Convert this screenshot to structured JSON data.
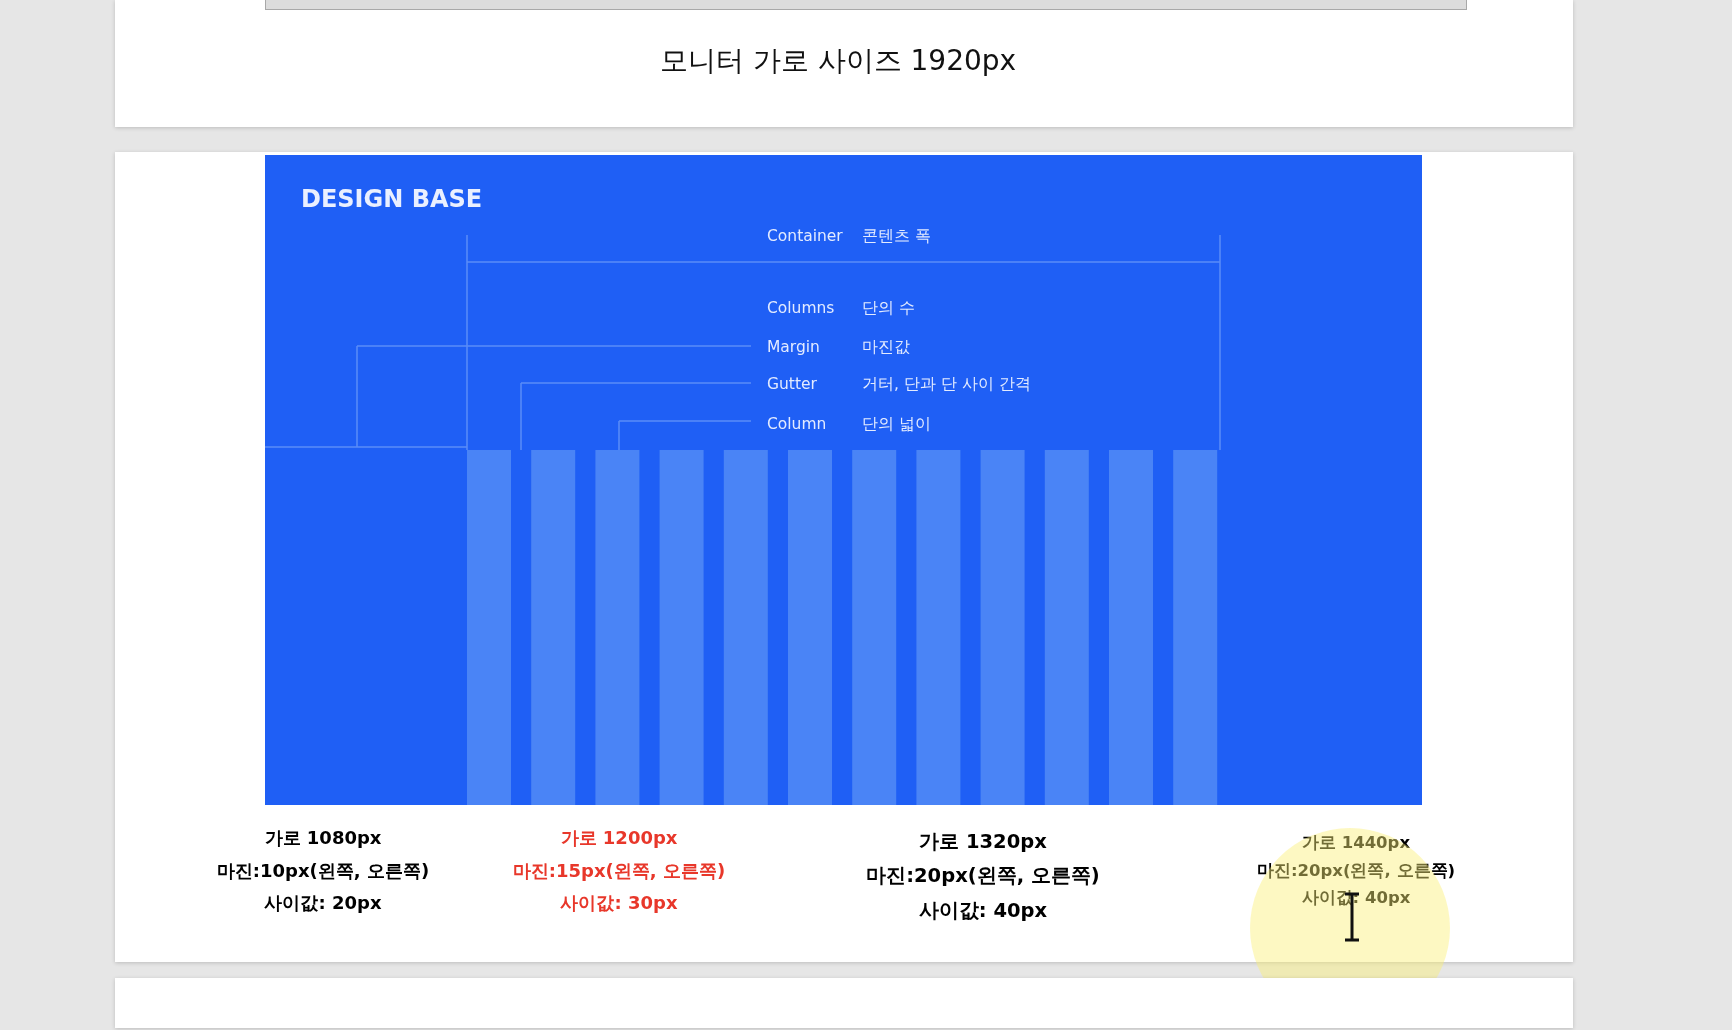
{
  "pages": [
    {
      "caption": "모니터 가로 사이즈 1920px"
    },
    {
      "figure": {
        "title": "DESIGN BASE",
        "legend": [
          {
            "term": "Container",
            "meaning": "콘텐츠 폭"
          },
          {
            "term": "Columns",
            "meaning": "단의 수"
          },
          {
            "term": "Margin",
            "meaning": "마진값"
          },
          {
            "term": "Gutter",
            "meaning": "거터, 단과 단 사이 간격"
          },
          {
            "term": "Column",
            "meaning": "단의 넓이"
          }
        ]
      },
      "specs": [
        {
          "width": "가로 1080px",
          "margin": "마진:10px(왼쪽, 오른쪽)",
          "gutter": "사이값: 20px",
          "color": "#000000"
        },
        {
          "width": "가로 1200px",
          "margin": "마진:15px(왼쪽, 오른쪽)",
          "gutter": "사이값: 30px",
          "color": "#e8372a"
        },
        {
          "width": "가로 1320px",
          "margin": "마진:20px(왼쪽, 오른쪽)",
          "gutter": "사이값: 40px",
          "color": "#000000"
        },
        {
          "width": "가로 1440px",
          "margin": "마진:20px(왼쪽, 오른쪽)",
          "gutter": "사이값: 40px",
          "color": "#000000"
        }
      ]
    }
  ]
}
